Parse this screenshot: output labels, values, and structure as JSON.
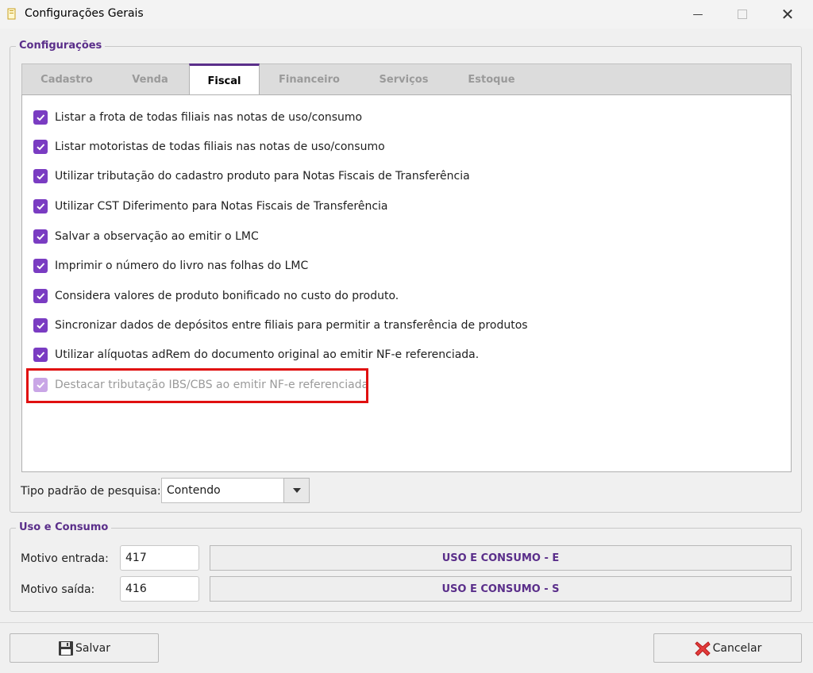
{
  "window": {
    "title": "Configurações Gerais",
    "minimize": "—",
    "close": "✕"
  },
  "configuracoes": {
    "legend": "Configurações",
    "tabs": [
      {
        "label": "Cadastro",
        "active": false
      },
      {
        "label": "Venda",
        "active": false
      },
      {
        "label": "Fiscal",
        "active": true
      },
      {
        "label": "Financeiro",
        "active": false
      },
      {
        "label": "Serviços",
        "active": false
      },
      {
        "label": "Estoque",
        "active": false
      }
    ],
    "fiscal_options": [
      {
        "label": "Listar a frota de todas filiais nas notas de uso/consumo",
        "checked": true,
        "enabled": true
      },
      {
        "label": "Listar motoristas de todas filiais nas notas de uso/consumo",
        "checked": true,
        "enabled": true
      },
      {
        "label": "Utilizar tributação do cadastro produto para Notas Fiscais de Transferência",
        "checked": true,
        "enabled": true
      },
      {
        "label": "Utilizar CST Diferimento para Notas Fiscais de Transferência",
        "checked": true,
        "enabled": true
      },
      {
        "label": "Salvar a observação ao emitir o LMC",
        "checked": true,
        "enabled": true
      },
      {
        "label": "Imprimir o número do livro nas folhas do LMC",
        "checked": true,
        "enabled": true
      },
      {
        "label": "Considera valores de produto bonificado no custo do produto.",
        "checked": true,
        "enabled": true
      },
      {
        "label": "Sincronizar dados de depósitos entre filiais para permitir a transferência de produtos",
        "checked": true,
        "enabled": true
      },
      {
        "label": "Utilizar alíquotas adRem do documento original ao emitir NF-e referenciada.",
        "checked": true,
        "enabled": true
      },
      {
        "label": "Destacar tributação IBS/CBS ao emitir NF-e referenciada",
        "checked": true,
        "enabled": false
      }
    ],
    "search_type": {
      "label": "Tipo padrão de pesquisa:",
      "value": "Contendo"
    }
  },
  "uso_consumo": {
    "legend": "Uso e Consumo",
    "entrada": {
      "label": "Motivo entrada:",
      "code": "417",
      "description": "USO E CONSUMO - E"
    },
    "saida": {
      "label": "Motivo saída:",
      "code": "416",
      "description": "USO E CONSUMO - S"
    }
  },
  "buttons": {
    "save": "Salvar",
    "cancel": "Cancelar"
  },
  "colors": {
    "accent": "#7a3cc2",
    "legend_text": "#5a2e8a",
    "highlight_border": "#e01010"
  }
}
